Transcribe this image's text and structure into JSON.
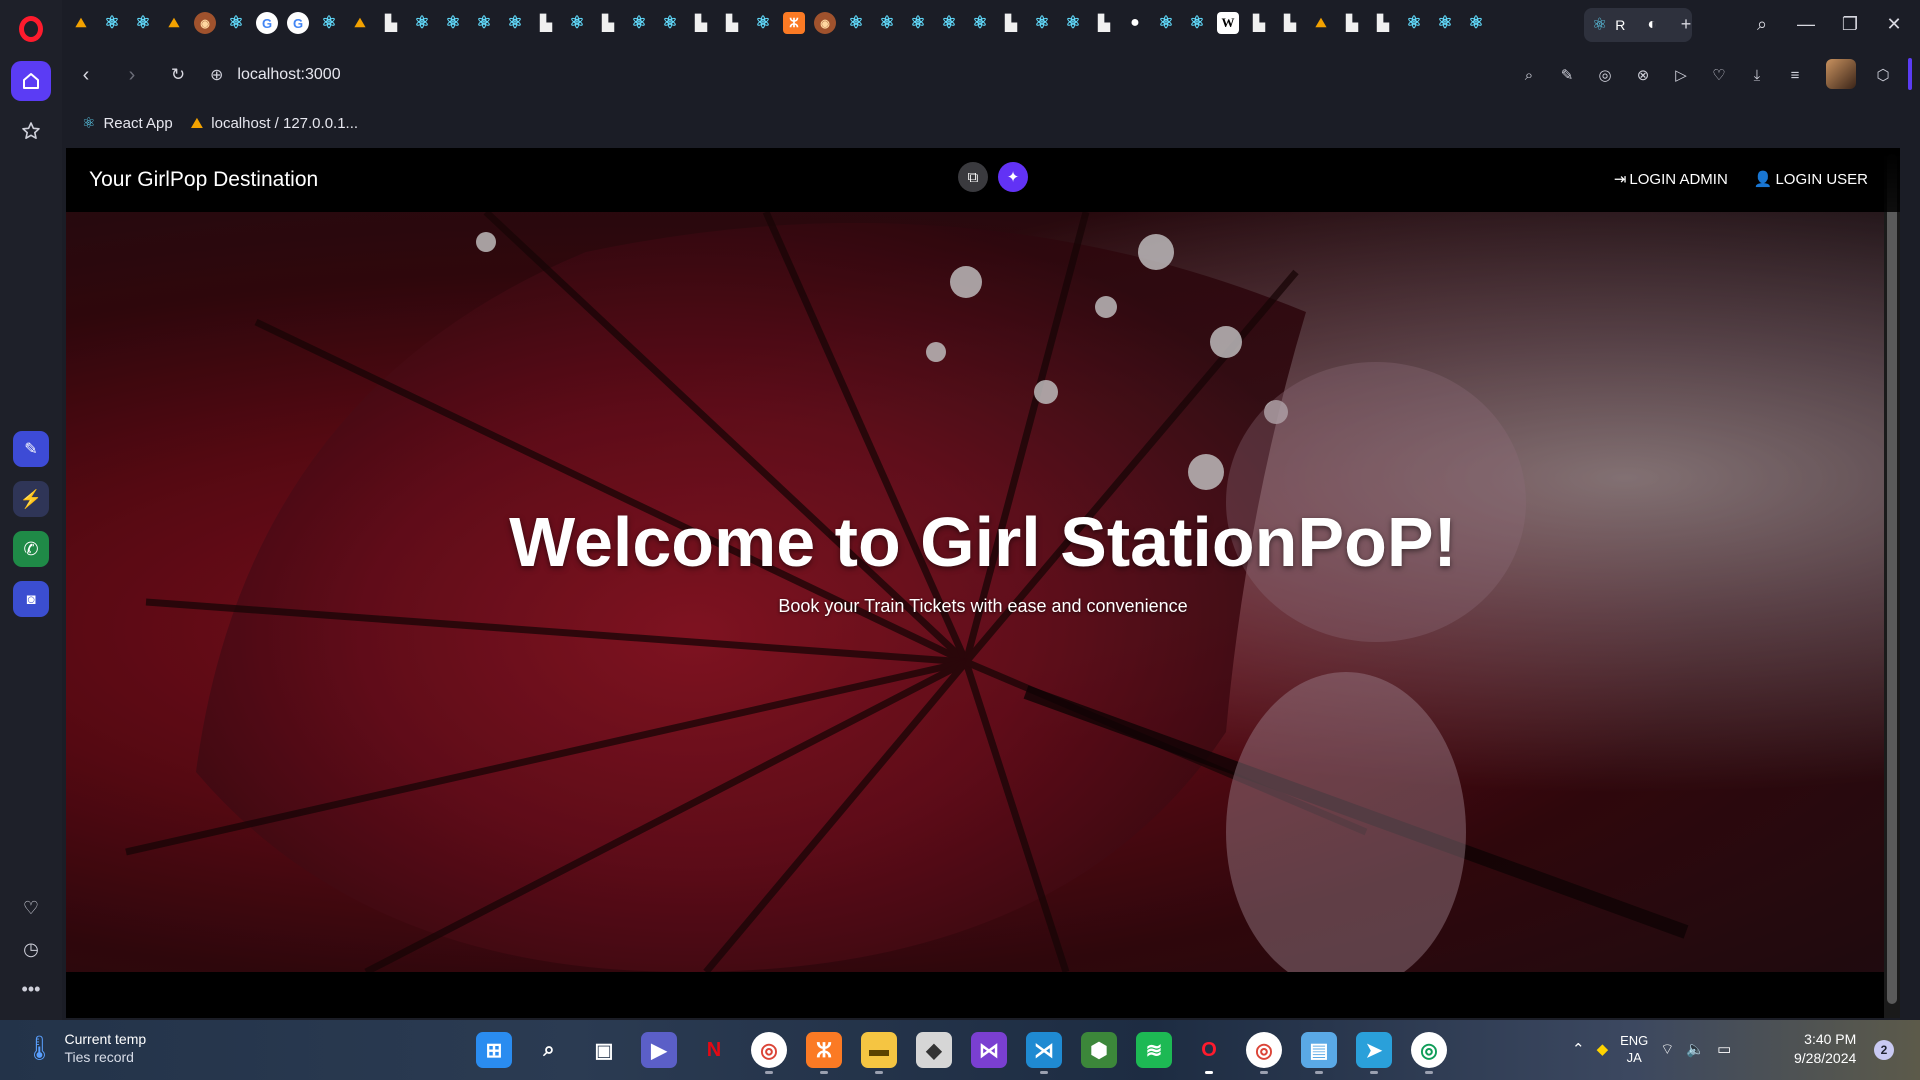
{
  "browser": {
    "tabs": {
      "icons": [
        "pma",
        "react",
        "react",
        "pma",
        "shield",
        "react",
        "google",
        "google",
        "react",
        "pma",
        "doc",
        "react",
        "react",
        "react",
        "react",
        "doc",
        "react",
        "doc",
        "react",
        "react",
        "doc",
        "doc",
        "react",
        "xampp",
        "shield",
        "react",
        "react",
        "react",
        "react",
        "react",
        "doc",
        "react",
        "react",
        "doc",
        "github",
        "react",
        "react",
        "wikipedia",
        "doc",
        "doc",
        "pma",
        "doc",
        "doc",
        "react",
        "react",
        "react"
      ],
      "active_tab_label": "R"
    },
    "address_bar": {
      "url": "localhost:3000"
    },
    "bookmarks": [
      {
        "label": "React App",
        "icon": "react-icon"
      },
      {
        "label": "localhost / 127.0.0.1...",
        "icon": "phpmyadmin-icon"
      }
    ]
  },
  "page": {
    "brand": "Your GirlPop Destination",
    "nav_links": [
      {
        "label": "LOGIN ADMIN",
        "icon": "login-icon"
      },
      {
        "label": "LOGIN USER",
        "icon": "user-plus-icon"
      }
    ],
    "hero": {
      "title": "Welcome to Girl StationPoP!",
      "subtitle": "Book your Train Tickets with ease and convenience"
    }
  },
  "taskbar": {
    "weather": {
      "title": "Current temp",
      "subtitle": "Ties record"
    },
    "apps": [
      "windows-start",
      "search",
      "task-view",
      "meet",
      "netflix",
      "chrome",
      "xampp",
      "file-explorer",
      "notes",
      "visual-studio",
      "vscode",
      "nodejs",
      "spotify",
      "opera",
      "chrome-profile",
      "notepad",
      "telegram",
      "chrome-alt"
    ],
    "language": {
      "line1": "ENG",
      "line2": "JA"
    },
    "clock": {
      "time": "3:40 PM",
      "date": "9/28/2024"
    },
    "notification_count": "2"
  }
}
